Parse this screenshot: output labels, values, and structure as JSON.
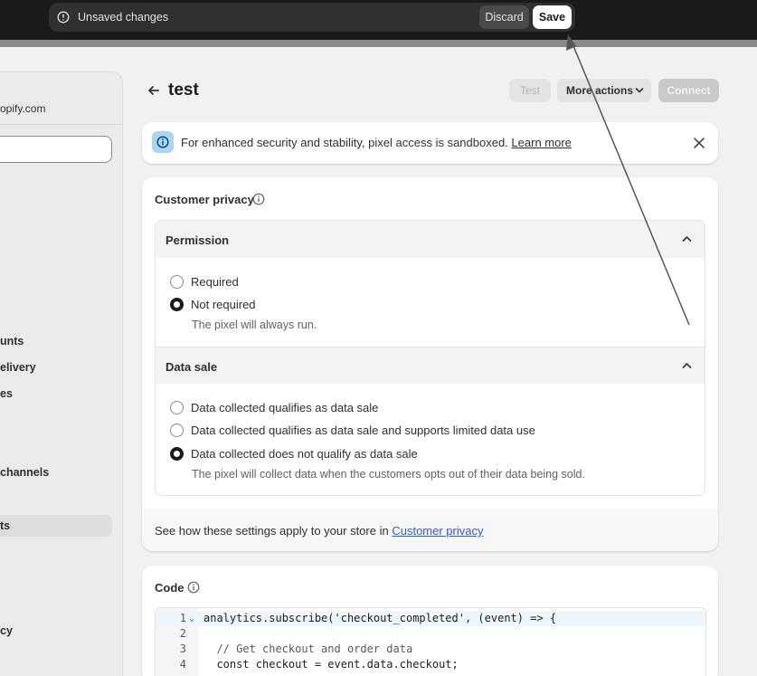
{
  "save_bar": {
    "message": "Unsaved changes",
    "discard_label": "Discard",
    "save_label": "Save"
  },
  "sidebar": {
    "store_domain": "opify.com",
    "items": [
      {
        "label": "unts"
      },
      {
        "label": "elivery"
      },
      {
        "label": "es"
      },
      {
        "label": " channels"
      },
      {
        "label": "ts"
      },
      {
        "label": "cy"
      }
    ],
    "active_item_label": "ts"
  },
  "page": {
    "title": "test",
    "test_label": "Test",
    "more_actions_label": "More actions",
    "connect_label": "Connect"
  },
  "banner": {
    "text": "For enhanced security and stability, pixel access is sandboxed.",
    "link_label": "Learn more"
  },
  "customer_privacy": {
    "title": "Customer privacy",
    "permission": {
      "heading": "Permission",
      "options": [
        {
          "label": "Required",
          "checked": false
        },
        {
          "label": "Not required",
          "checked": true
        }
      ],
      "helper": "The pixel will always run."
    },
    "data_sale": {
      "heading": "Data sale",
      "options": [
        {
          "label": "Data collected qualifies as data sale",
          "checked": false
        },
        {
          "label": "Data collected qualifies as data sale and supports limited data use",
          "checked": false
        },
        {
          "label": "Data collected does not qualify as data sale",
          "checked": true
        }
      ],
      "helper": "The pixel will collect data when the customers opts out of their data being sold."
    },
    "footer_text": "See how these settings apply to your store in",
    "footer_link": "Customer privacy"
  },
  "code": {
    "title": "Code",
    "lines": [
      {
        "num": "1",
        "text": "analytics.subscribe('checkout_completed', (event) => {"
      },
      {
        "num": "2",
        "text": ""
      },
      {
        "num": "3",
        "text": "  // Get checkout and order data"
      },
      {
        "num": "4",
        "text": "  const checkout = event.data.checkout;"
      }
    ]
  },
  "colors": {
    "accent_link": "#2a5bd7",
    "banner_icon_bg": "#a8d7f5",
    "save_bar_bg": "#303030"
  }
}
